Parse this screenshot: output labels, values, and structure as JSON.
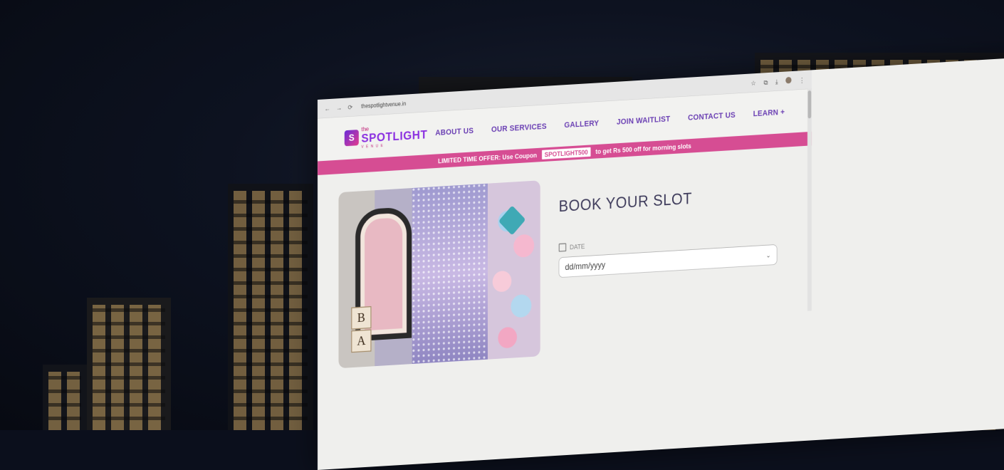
{
  "browser": {
    "url": "thespotlightvenue.in",
    "icons": [
      "back-arrow-icon",
      "forward-arrow-icon",
      "reload-icon",
      "star-icon",
      "extension-icon",
      "download-icon",
      "profile-avatar",
      "menu-dots-icon"
    ]
  },
  "brand": {
    "the": "the",
    "name": "SPOTLIGHT",
    "sub": "VENUE",
    "mark": "S"
  },
  "nav": {
    "items": [
      "ABOUT US",
      "OUR SERVICES",
      "GALLERY",
      "JOIN WAITLIST",
      "CONTACT US",
      "LEARN +"
    ]
  },
  "promo": {
    "prefix": "LIMITED TIME OFFER: Use Coupon",
    "code": "SPOTLIGHT500",
    "suffix": "to get Rs 500 off for morning slots"
  },
  "hero": {
    "blocks": [
      "B",
      "A"
    ]
  },
  "booking": {
    "title": "BOOK YOUR SLOT",
    "date_label": "DATE",
    "date_placeholder": "dd/mm/yyyy"
  },
  "colors": {
    "accent_pink": "#d64d93",
    "nav_purple": "#6a3fb3",
    "night_sky": "#0b0f1c"
  }
}
